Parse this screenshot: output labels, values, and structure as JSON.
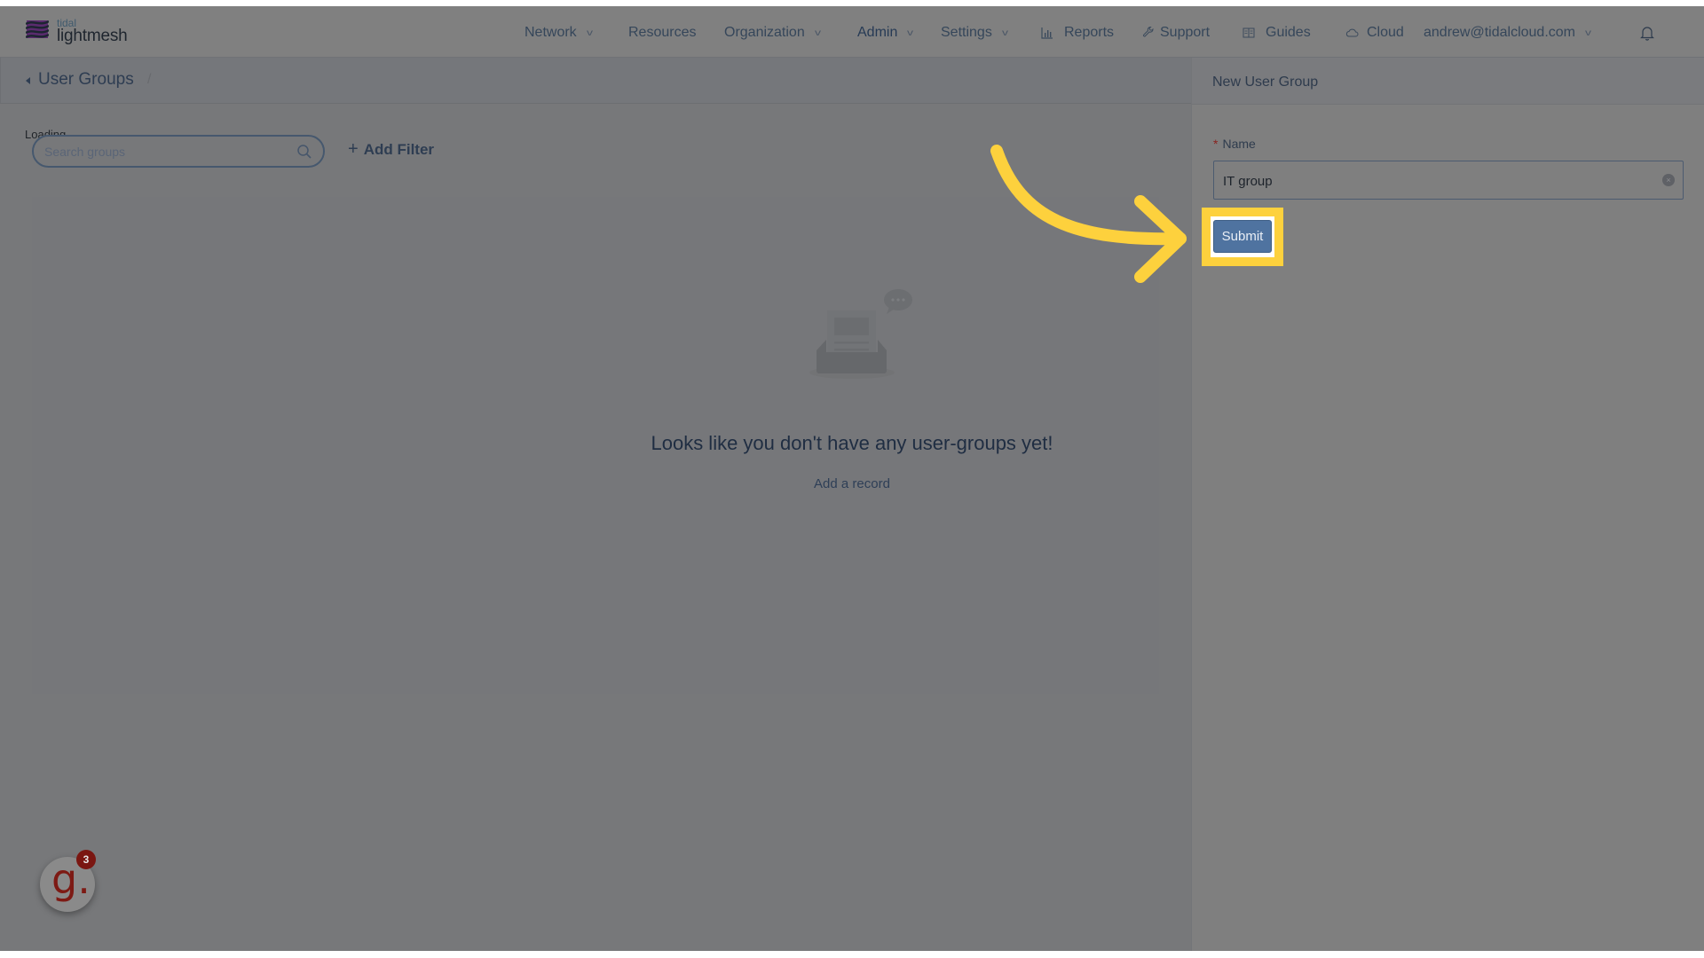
{
  "app": {
    "logo_small": "tidal",
    "logo_big": "lightmesh"
  },
  "nav": {
    "items": [
      {
        "label": "Network",
        "dropdown": true,
        "icon": null
      },
      {
        "label": "Resources",
        "dropdown": false,
        "icon": null
      },
      {
        "label": "Organization",
        "dropdown": true,
        "icon": null
      },
      {
        "label": "Admin",
        "dropdown": true,
        "icon": null
      },
      {
        "label": "Settings",
        "dropdown": true,
        "icon": null
      },
      {
        "label": "Reports",
        "dropdown": false,
        "icon": "bar-chart-icon"
      },
      {
        "label": "Support",
        "dropdown": false,
        "icon": "wrench-icon"
      },
      {
        "label": "Guides",
        "dropdown": false,
        "icon": "book-icon"
      },
      {
        "label": "Cloud",
        "dropdown": false,
        "icon": "cloud-icon"
      }
    ],
    "user_email": "andrew@tidalcloud.com",
    "chevron": "v",
    "notification_icon": "bell-icon"
  },
  "breadcrumb": {
    "title": "User Groups",
    "separator": "/"
  },
  "main": {
    "loading_text": "Loading",
    "search_placeholder": "Search groups",
    "add_filter_plus": "+",
    "add_filter_label": "Add Filter",
    "empty_title": "Looks like you don't have any user-groups yet!",
    "add_record_label": "Add a record"
  },
  "panel": {
    "title": "New User Group",
    "required_mark": "*",
    "name_label": "Name",
    "name_value": "IT group",
    "clear_glyph": "×",
    "submit_label": "Submit"
  },
  "annotation": {
    "highlight_color": "#fdd13d",
    "arrow_color": "#fdd13d"
  },
  "help_widget": {
    "glyph": "g.",
    "badge_count": "3"
  }
}
